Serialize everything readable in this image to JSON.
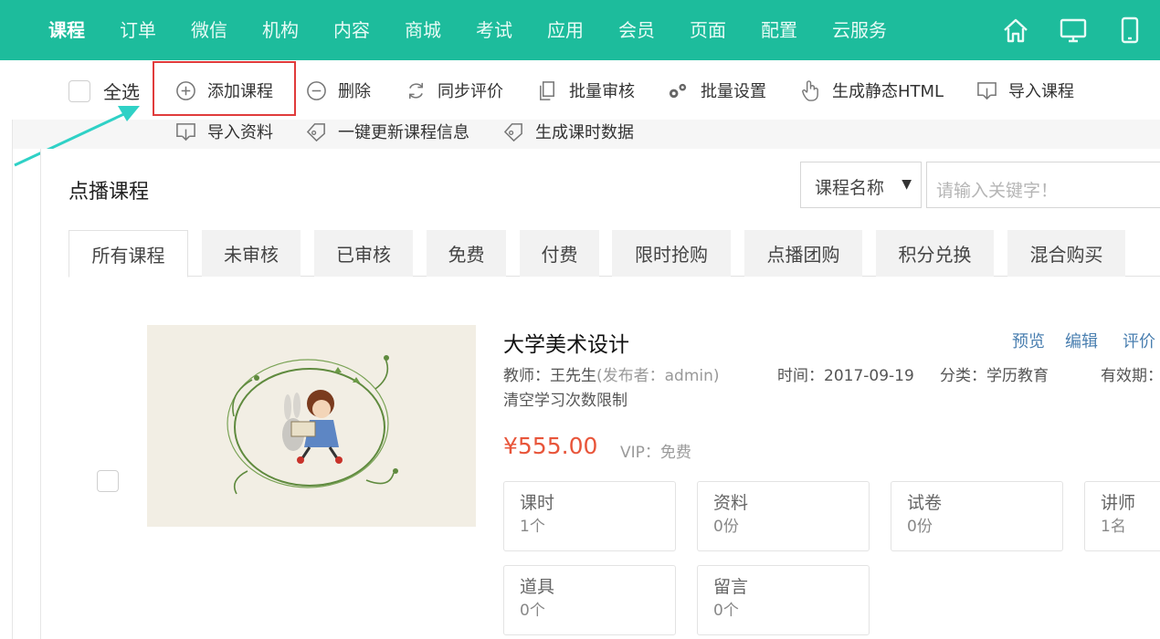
{
  "nav": {
    "items": [
      "课程",
      "订单",
      "微信",
      "机构",
      "内容",
      "商城",
      "考试",
      "应用",
      "会员",
      "页面",
      "配置",
      "云服务"
    ],
    "icons": [
      "home-icon",
      "desktop-icon",
      "mobile-icon"
    ]
  },
  "toolbar": {
    "select_all": "全选",
    "row1": [
      "添加课程",
      "删除",
      "同步评价",
      "批量审核",
      "批量设置",
      "生成静态HTML",
      "导入课程"
    ],
    "row2": [
      "导入资料",
      "一键更新课程信息",
      "生成课时数据"
    ]
  },
  "page": {
    "title": "点播课程",
    "search_field": "课程名称",
    "search_placeholder": "请输入关键字！"
  },
  "tabs": [
    "所有课程",
    "未审核",
    "已审核",
    "免费",
    "付费",
    "限时抢购",
    "点播团购",
    "积分兑换",
    "混合购买"
  ],
  "course": {
    "title": "大学美术设计",
    "actions": [
      "预览",
      "编辑",
      "评价"
    ],
    "teacher": "教师：王先生",
    "publisher": "(发布者：admin)",
    "time": "时间：2017-09-19",
    "category": "分类：学历教育",
    "validity": "有效期：",
    "desc": "清空学习次数限制",
    "price": "¥555.00",
    "vip": "VIP：免费",
    "stats": [
      {
        "label": "课时",
        "value": "1个"
      },
      {
        "label": "资料",
        "value": "0份"
      },
      {
        "label": "试卷",
        "value": "0份"
      },
      {
        "label": "讲师",
        "value": "1名"
      },
      {
        "label": "道具",
        "value": "0个"
      },
      {
        "label": "留言",
        "value": "0个"
      }
    ]
  },
  "colors": {
    "nav_bg": "#1dbc9c",
    "highlight": "#e03b3b",
    "arrow": "#2fd1c6",
    "price": "#e8553a",
    "link": "#4a7fb0"
  }
}
